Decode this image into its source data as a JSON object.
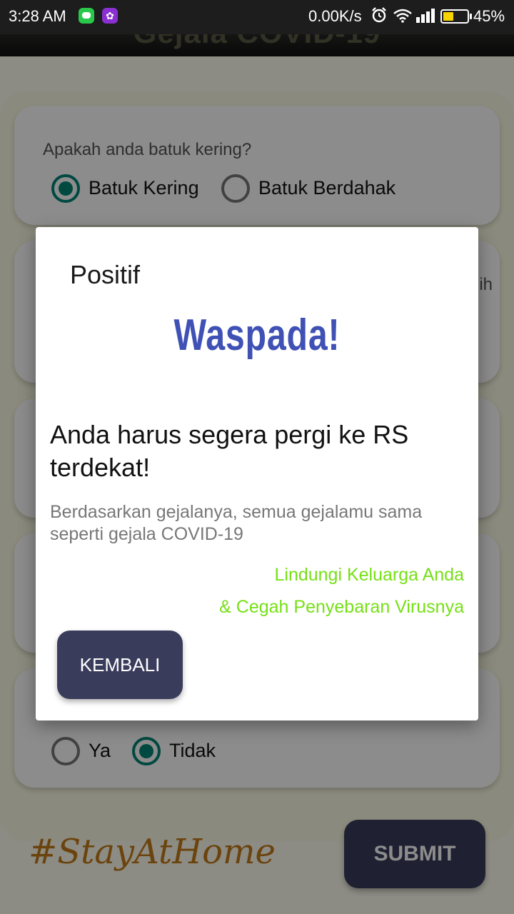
{
  "status_bar": {
    "time": "3:28 AM",
    "net_speed": "0.00K/s",
    "battery_pct": "45%",
    "battery_level": 0.45,
    "icons": [
      "messenger-app-icon",
      "cleaner-app-icon",
      "alarm-icon",
      "wifi-icon",
      "signal-icon",
      "battery-icon"
    ]
  },
  "app_bar": {
    "title": "Gejala COVID-19"
  },
  "form": {
    "q1": {
      "text": "Apakah anda batuk kering?",
      "options": [
        "Batuk Kering",
        "Batuk Berdahak"
      ],
      "selected": 0
    },
    "q2": {
      "partial_text": "ih"
    },
    "q5": {
      "options": [
        "Ya",
        "Tidak"
      ],
      "selected": 1
    },
    "tagline": "#StayAtHome",
    "submit_label": "SUBMIT"
  },
  "dialog": {
    "title": "Positif",
    "heading": "Waspada!",
    "message": "Anda harus segera pergi ke RS terdekat!",
    "description": "Berdasarkan gejalanya, semua gejalamu sama seperti gejala COVID-19",
    "tagline_1": "Lindungi Keluarga Anda",
    "tagline_2": "& Cegah Penyebaran Virusnya",
    "back_label": "KEMBALI"
  },
  "colors": {
    "accent_radio": "#008577",
    "heading": "#3f51b5",
    "tagline": "#76e016",
    "button": "#3a3c5c"
  }
}
